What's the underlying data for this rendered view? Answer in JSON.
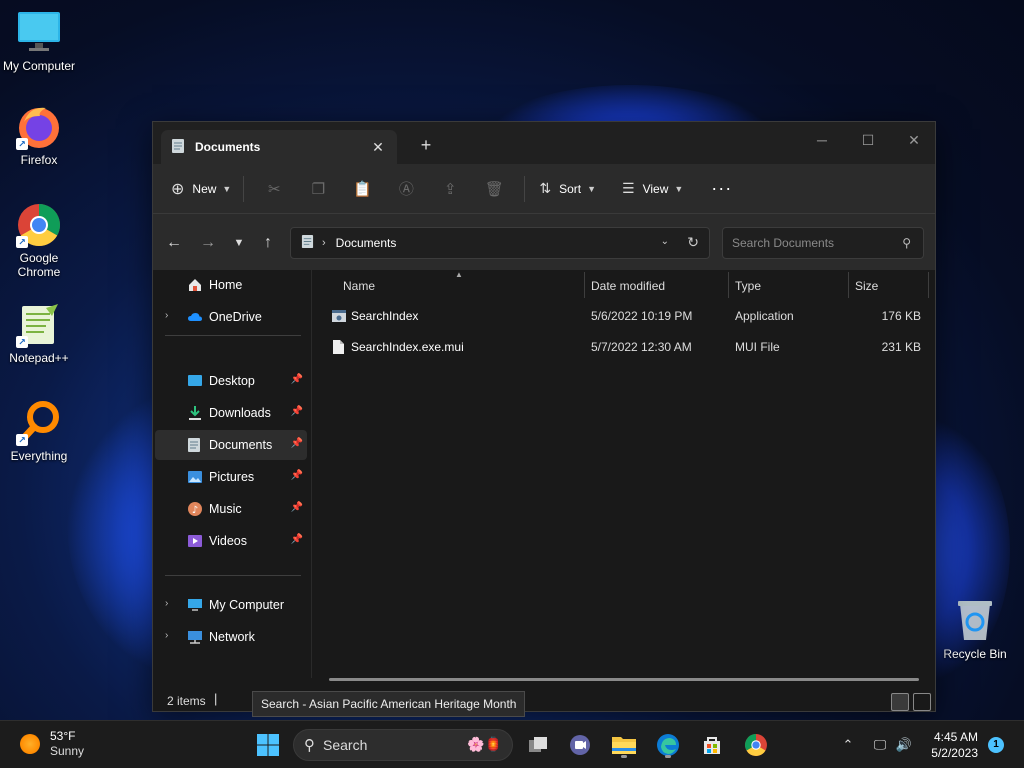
{
  "desktop": {
    "icons": [
      {
        "label": "My Computer"
      },
      {
        "label": "Firefox"
      },
      {
        "label": "Google Chrome"
      },
      {
        "label": "Notepad++"
      },
      {
        "label": "Everything"
      },
      {
        "label": "Recycle Bin"
      }
    ]
  },
  "window": {
    "tab_title": "Documents",
    "toolbar": {
      "new_label": "New",
      "sort_label": "Sort",
      "view_label": "View",
      "more_label": "···"
    },
    "address": {
      "crumb": "Documents",
      "search_placeholder": "Search Documents"
    },
    "nav": {
      "home": "Home",
      "onedrive": "OneDrive",
      "desktop": "Desktop",
      "downloads": "Downloads",
      "documents": "Documents",
      "pictures": "Pictures",
      "music": "Music",
      "videos": "Videos",
      "mycomputer": "My Computer",
      "network": "Network"
    },
    "columns": {
      "name": "Name",
      "date": "Date modified",
      "type": "Type",
      "size": "Size"
    },
    "files": [
      {
        "name": "SearchIndex",
        "date": "5/6/2022 10:19 PM",
        "type": "Application",
        "size": "176 KB"
      },
      {
        "name": "SearchIndex.exe.mui",
        "date": "5/7/2022 12:30 AM",
        "type": "MUI File",
        "size": "231 KB"
      }
    ],
    "status": {
      "count": "2 items",
      "separator": "|"
    }
  },
  "tooltip": "Search - Asian Pacific American Heritage Month",
  "taskbar": {
    "weather_temp": "53°F",
    "weather_desc": "Sunny",
    "search_placeholder": "Search",
    "time": "4:45 AM",
    "date": "5/2/2023",
    "notifications": "1"
  },
  "colors": {
    "accent": "#4cc2ff",
    "folder": "#f4c542"
  }
}
